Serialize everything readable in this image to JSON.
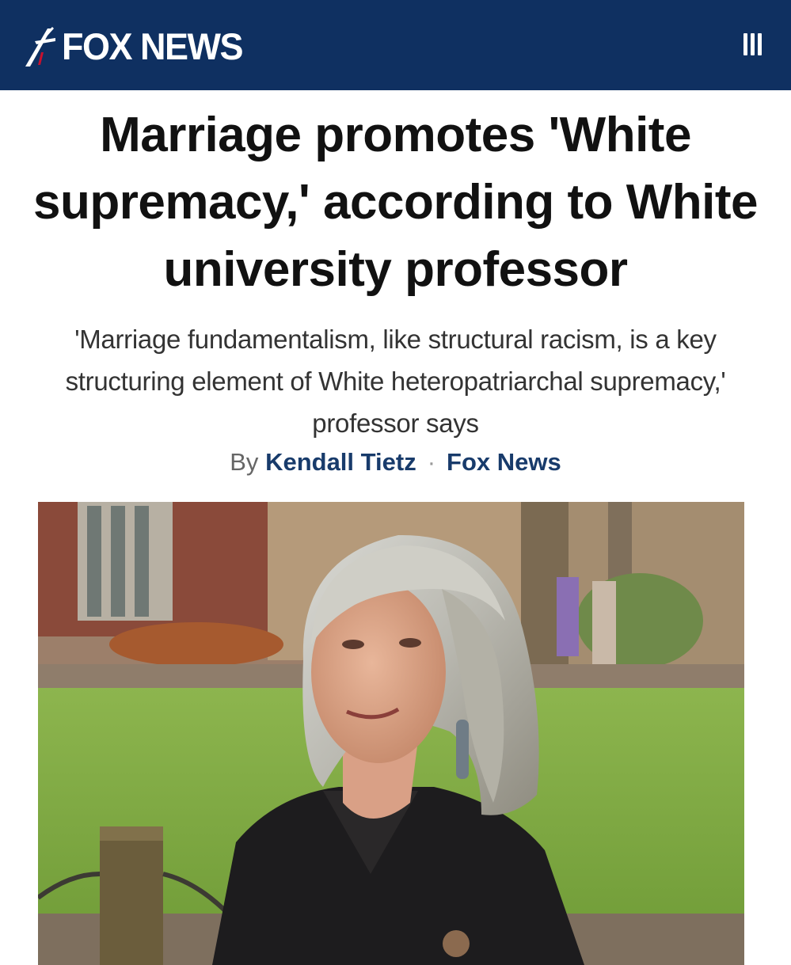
{
  "header": {
    "logo_text": "FOX NEWS",
    "logo_icon": "fox-news-logo-icon",
    "menu_icon": "hamburger-menu-icon",
    "background_color": "#0f3061"
  },
  "article": {
    "headline": "Marriage promotes 'White supremacy,' according to White university professor",
    "subheadline": "'Marriage fundamentalism, like structural racism, is a key structuring element of White heteropatriarchal supremacy,' professor says",
    "byline_prefix": "By",
    "author": "Kendall Tietz",
    "separator": "·",
    "source": "Fox News",
    "link_color": "#183b6b"
  },
  "photo": {
    "subject": "woman with gray bob haircut outdoors on a campus lawn"
  }
}
